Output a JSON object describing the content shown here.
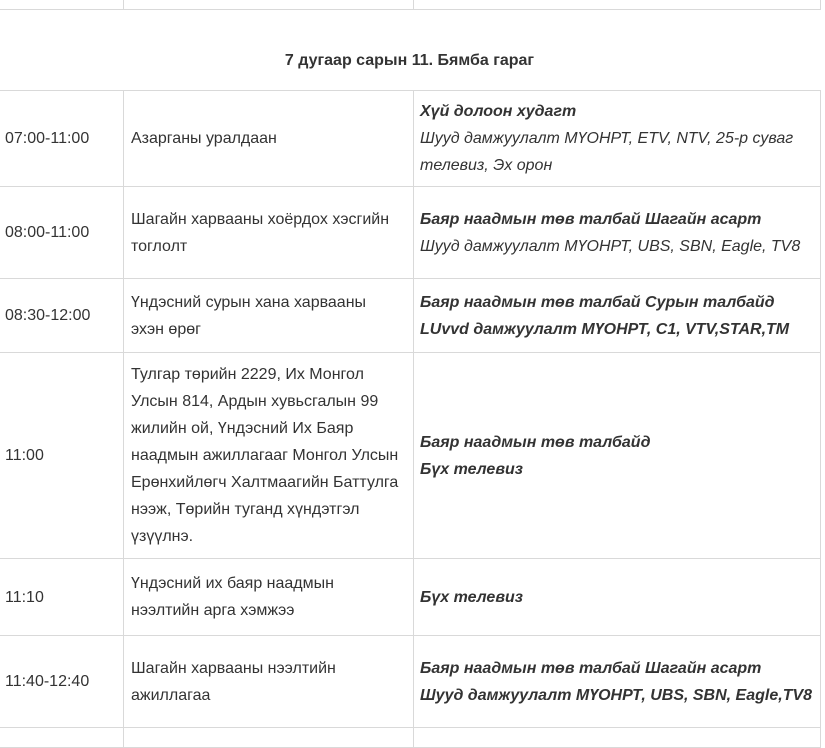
{
  "date_heading": "7 дугаар сарын 11. Бямба гараг",
  "rows": [
    {
      "time": "07:00-11:00",
      "event": "Азарганы уралдаан",
      "info_bold": "Хүй долоон худагт",
      "info_normal": "Шууд дамжуулалт МҮОНРТ, ETV, NTV, 25-р суваг телевиз, Эх орон"
    },
    {
      "time": "08:00-11:00",
      "event": "Шагайн харвааны хоёрдох хэсгийн тоглолт",
      "info_bold": "Баяр наадмын төв талбай Шагайн асарт",
      "info_normal": "Шууд дамжуулалт МҮОНРТ, UBS, SBN, Eagle, TV8"
    },
    {
      "time": "08:30-12:00",
      "event": "Үндэсний сурын хана харвааны эхэн өрөг",
      "info_bold": "Баяр наадмын төв талбай Сурын талбайд",
      "info_bold2": "LUvvd дамжуулалт МҮОНРТ, C1, VTV,STAR,TM"
    },
    {
      "time": "11:00",
      "event": "Тулгар төрийн 2229, Их Монгол Улсын 814, Ардын хувьсгалын 99 жилийн ой, Үндэсний Их Баяр наадмын ажиллагааг Монгол Улсын Ерөнхийлөгч Халтмаагийн Баттулга нээж, Төрийн туганд хүндэтгэл үзүүлнэ.",
      "info_bold": "Баяр наадмын төв талбайд",
      "info_bold2": "Бүх телевиз"
    },
    {
      "time": "11:10",
      "event": "Үндэсний их баяр наадмын нээлтийн арга хэмжээ",
      "info_bold": "Бүх телевиз"
    },
    {
      "time": "11:40-12:40",
      "event": "Шагайн харвааны нээлтийн ажиллагаа",
      "info_bold": "Баяр наадмын төв талбай Шагайн асарт",
      "info_bold2": "Шууд дамжуулалт МҮОНРТ, UBS, SBN, Eagle,TV8"
    }
  ]
}
